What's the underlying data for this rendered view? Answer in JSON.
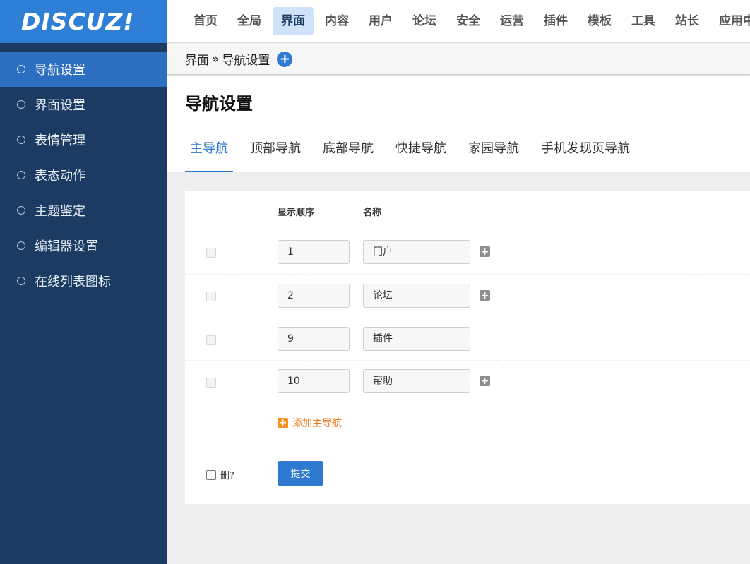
{
  "logo": {
    "text": "DISCUZ!"
  },
  "sidebar": {
    "items": [
      {
        "label": "导航设置",
        "active": true
      },
      {
        "label": "界面设置"
      },
      {
        "label": "表情管理"
      },
      {
        "label": "表态动作"
      },
      {
        "label": "主题鉴定"
      },
      {
        "label": "编辑器设置"
      },
      {
        "label": "在线列表图标"
      }
    ]
  },
  "topnav": {
    "items": [
      {
        "label": "首页"
      },
      {
        "label": "全局"
      },
      {
        "label": "界面",
        "active": true
      },
      {
        "label": "内容"
      },
      {
        "label": "用户"
      },
      {
        "label": "论坛"
      },
      {
        "label": "安全"
      },
      {
        "label": "运营"
      },
      {
        "label": "插件"
      },
      {
        "label": "模板"
      },
      {
        "label": "工具"
      },
      {
        "label": "站长"
      },
      {
        "label": "应用中心"
      }
    ]
  },
  "breadcrumb": {
    "parent": "界面",
    "separator": "»",
    "current": "导航设置",
    "add_icon": "plus-circle-icon"
  },
  "page": {
    "title": "导航设置"
  },
  "tabs": [
    {
      "label": "主导航",
      "active": true
    },
    {
      "label": "顶部导航"
    },
    {
      "label": "底部导航"
    },
    {
      "label": "快捷导航"
    },
    {
      "label": "家园导航"
    },
    {
      "label": "手机发现页导航"
    }
  ],
  "table": {
    "headers": {
      "order": "显示顺序",
      "name": "名称"
    },
    "rows": [
      {
        "order": "1",
        "name": "门户",
        "has_plus": true
      },
      {
        "order": "2",
        "name": "论坛",
        "has_plus": true
      },
      {
        "order": "9",
        "name": "插件",
        "has_plus": false
      },
      {
        "order": "10",
        "name": "帮助",
        "has_plus": true
      }
    ]
  },
  "add_link": {
    "label": "添加主导航"
  },
  "footer": {
    "delete_label": "删?",
    "submit_label": "提交"
  },
  "colors": {
    "sidebar_bg": "#1b3b63",
    "logo_bg": "#2f7fd6",
    "accent": "#2e7ad1",
    "add_link": "#f07a1a"
  }
}
